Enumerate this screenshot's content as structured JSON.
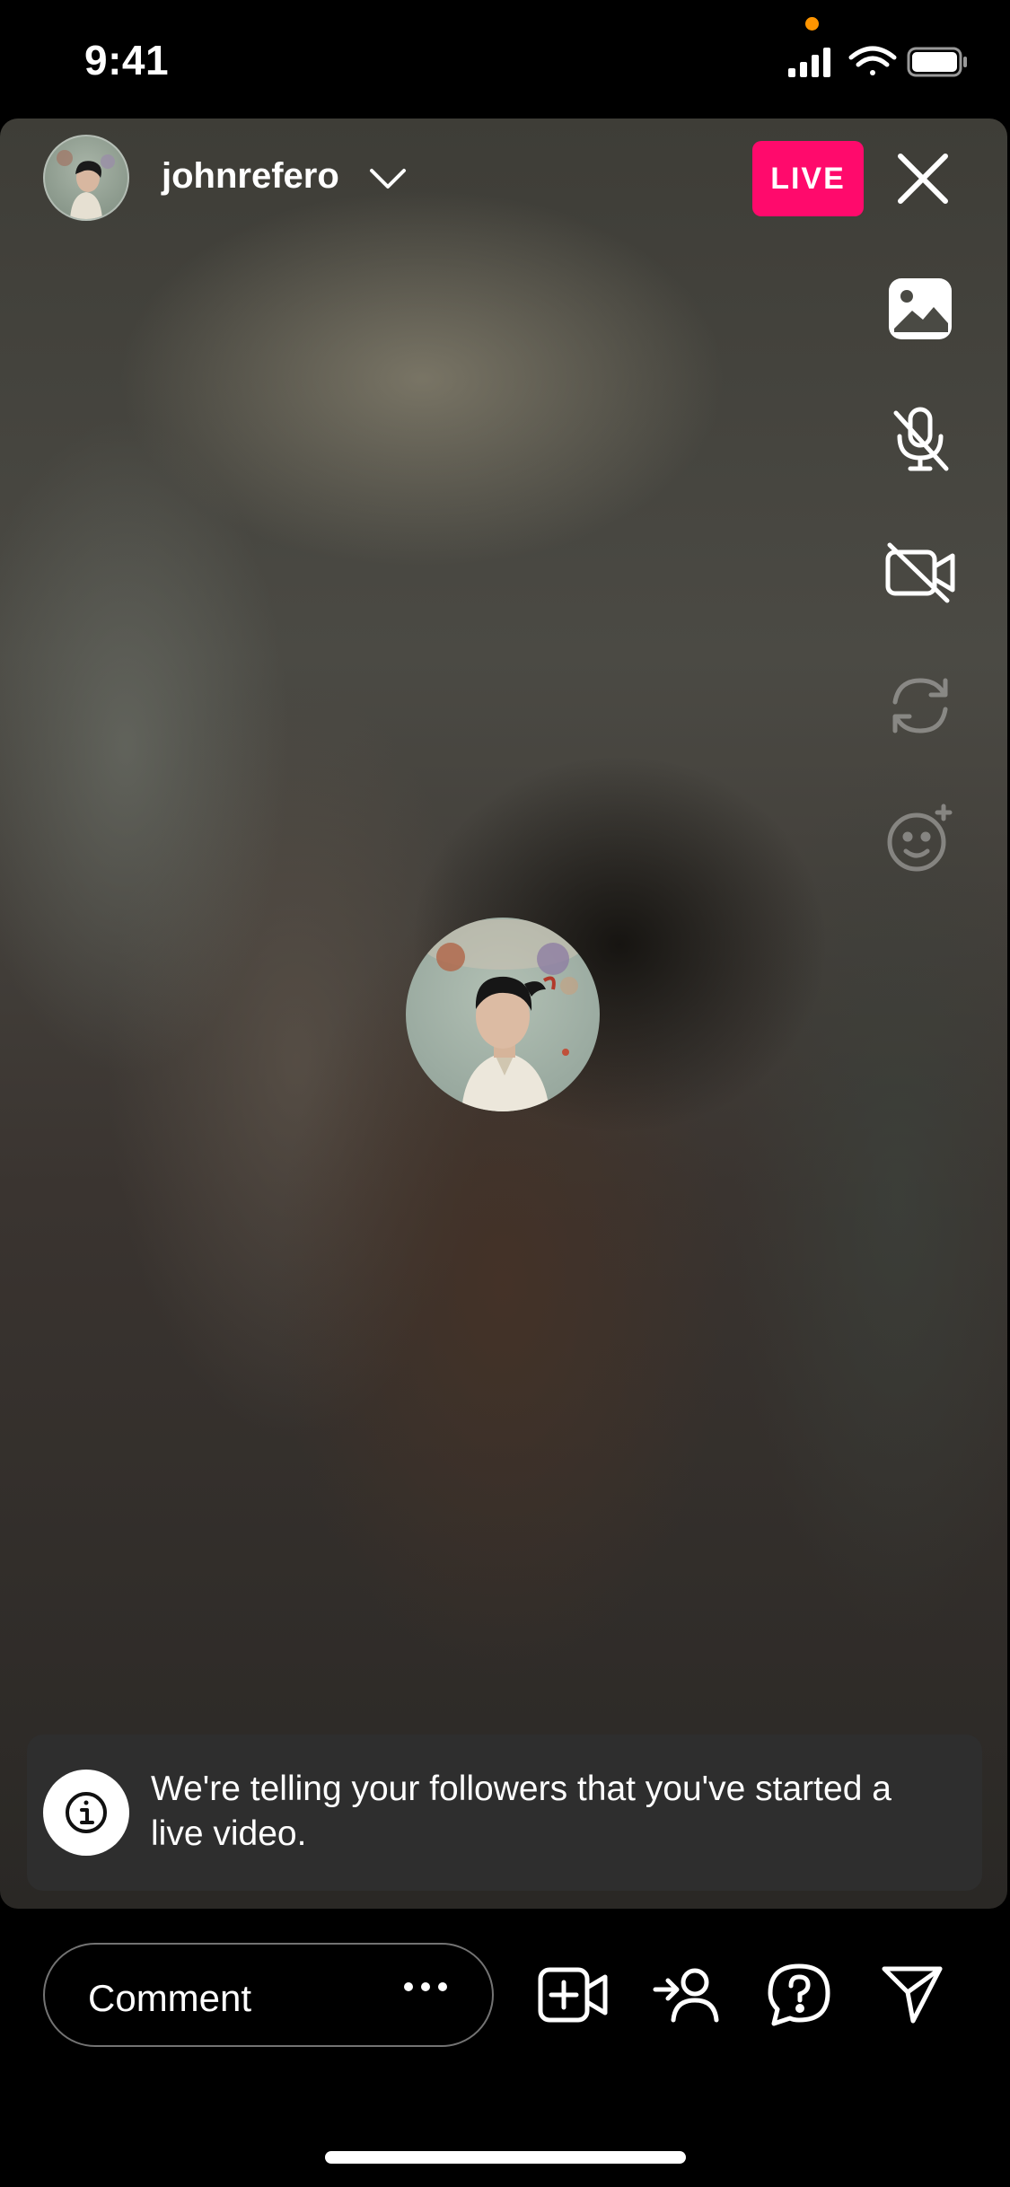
{
  "status_bar": {
    "time": "9:41"
  },
  "live": {
    "username": "johnrefero",
    "badge": "LIVE",
    "side_tools": [
      "photo-icon",
      "microphone-muted-icon",
      "camera-off-icon",
      "flip-camera-icon",
      "effects-icon"
    ]
  },
  "notice": {
    "text": "We're telling your followers that you've started a live video."
  },
  "bottom_bar": {
    "comment_placeholder": "Comment",
    "tools": [
      "add-video-guest-icon",
      "invite-user-icon",
      "question-icon",
      "send-icon"
    ]
  },
  "colors": {
    "live_badge": "#ff0a6c",
    "recording_dot": "#ff9500",
    "notice_bg": "#2e2e2e"
  }
}
